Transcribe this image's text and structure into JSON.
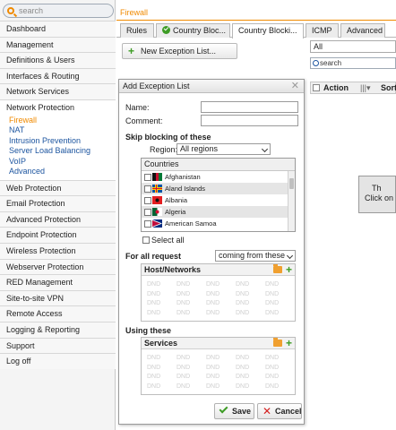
{
  "sidebar": {
    "search_placeholder": "search",
    "items_top": [
      "Dashboard",
      "Management",
      "Definitions & Users",
      "Interfaces & Routing",
      "Network Services"
    ],
    "group": "Network Protection",
    "subitems": [
      "Firewall",
      "NAT",
      "Intrusion Prevention",
      "Server Load Balancing",
      "VoIP",
      "Advanced"
    ],
    "items_bottom": [
      "Web Protection",
      "Email Protection",
      "Advanced Protection",
      "Endpoint Protection",
      "Wireless Protection",
      "Webserver Protection",
      "RED Management",
      "Site-to-site VPN",
      "Remote Access",
      "Logging & Reporting",
      "Support",
      "Log off"
    ]
  },
  "page": {
    "title": "Firewall"
  },
  "tabs": [
    "Rules",
    "Country Bloc...",
    "Country Blocki...",
    "ICMP",
    "Advanced"
  ],
  "toolbar": {
    "new_button": "New Exception List..."
  },
  "right": {
    "filter_value": "All",
    "search_placeholder": "search",
    "col_action": "Action",
    "col_sort": "Sort",
    "info_line1": "Th",
    "info_line2": "Click on"
  },
  "dialog": {
    "title": "Add Exception List",
    "name_label": "Name:",
    "comment_label": "Comment:",
    "skip_title": "Skip blocking of these",
    "region_label": "Region:",
    "region_value": "All regions",
    "countries_header": "Countries",
    "countries": [
      "Afghanistan",
      "Aland Islands",
      "Albania",
      "Algeria",
      "American Samoa"
    ],
    "select_all": "Select all",
    "for_all_label": "For all request",
    "for_all_value": "coming from these",
    "host_title": "Host/Networks",
    "using_title": "Using these",
    "services_title": "Services",
    "dnd": "DND",
    "save": "Save",
    "cancel": "Cancel"
  },
  "colors": {
    "accent": "#f08a00",
    "link": "#1e56a0",
    "ok": "#3d9c25",
    "cancel": "#d32020"
  }
}
